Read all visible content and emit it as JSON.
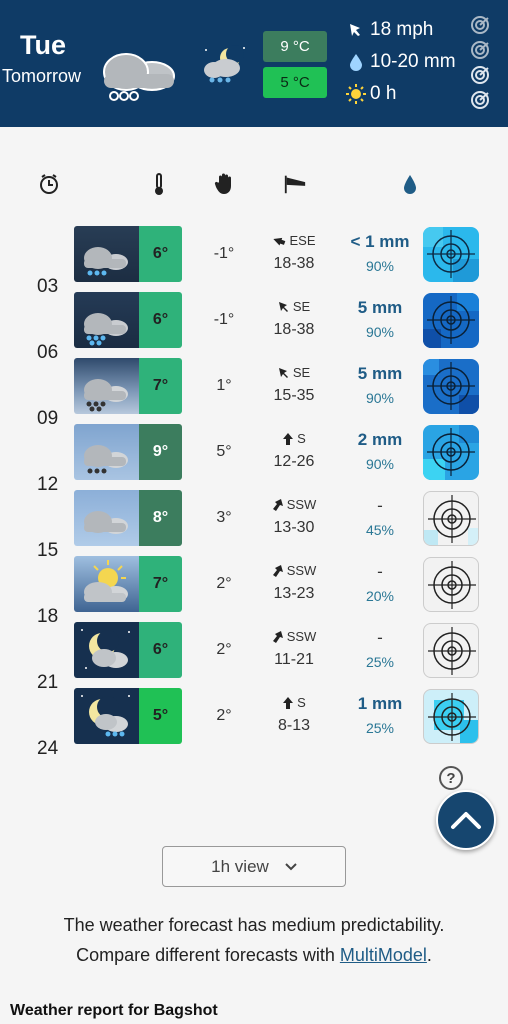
{
  "header": {
    "day": "Tue",
    "relative": "Tomorrow",
    "temp_high": "9 °C",
    "temp_low": "5 °C",
    "wind": "18 mph",
    "precip": "10-20 mm",
    "sun": "0 h"
  },
  "columns": [
    "clock-icon",
    "thermometer-icon",
    "hand-icon",
    "windsock-icon",
    "raindrop-icon"
  ],
  "hours": [
    "03",
    "06",
    "09",
    "12",
    "15",
    "18",
    "21",
    "24"
  ],
  "rows": [
    {
      "temp": "6°",
      "feels": "-1°",
      "dir": "ESE",
      "speed": "18-38",
      "precip": "< 1 mm",
      "prob": "90%",
      "temp_color": "#2fb27a",
      "radar_level": "light",
      "icon": "snow-cloud-dusk-icon"
    },
    {
      "temp": "6°",
      "feels": "-1°",
      "dir": "SE",
      "speed": "18-38",
      "precip": "5 mm",
      "prob": "90%",
      "temp_color": "#2fb27a",
      "radar_level": "heavy",
      "icon": "snow-cloud-dusk-icon"
    },
    {
      "temp": "7°",
      "feels": "1°",
      "dir": "SE",
      "speed": "15-35",
      "precip": "5 mm",
      "prob": "90%",
      "temp_color": "#2fb27a",
      "radar_level": "heavy",
      "icon": "snow-cloud-dawn-icon"
    },
    {
      "temp": "9°",
      "feels": "5°",
      "dir": "S",
      "speed": "12-26",
      "precip": "2 mm",
      "prob": "90%",
      "temp_color": "#3c7d5e",
      "radar_level": "medium",
      "icon": "snow-cloud-day-icon"
    },
    {
      "temp": "8°",
      "feels": "3°",
      "dir": "SSW",
      "speed": "13-30",
      "precip": "-",
      "prob": "45%",
      "temp_color": "#3c7d5e",
      "radar_level": "trace",
      "icon": "cloud-day-icon"
    },
    {
      "temp": "7°",
      "feels": "2°",
      "dir": "SSW",
      "speed": "13-23",
      "precip": "-",
      "prob": "20%",
      "temp_color": "#2fb27a",
      "radar_level": "none",
      "icon": "sun-cloud-dusk-icon"
    },
    {
      "temp": "6°",
      "feels": "2°",
      "dir": "SSW",
      "speed": "11-21",
      "precip": "-",
      "prob": "25%",
      "temp_color": "#2fb27a",
      "radar_level": "none",
      "icon": "moon-cloud-icon"
    },
    {
      "temp": "5°",
      "feels": "2°",
      "dir": "S",
      "speed": "8-13",
      "precip": "1 mm",
      "prob": "25%",
      "temp_color": "#20c155",
      "radar_level": "medium-light",
      "icon": "moon-snow-cloud-icon"
    }
  ],
  "view_select": "1h view",
  "note_line1": "The weather forecast has medium predictability.",
  "note_line2_prefix": "Compare different forecasts with ",
  "note_link": "MultiModel",
  "note_line2_suffix": ".",
  "report_title": "Weather report for Bagshot"
}
